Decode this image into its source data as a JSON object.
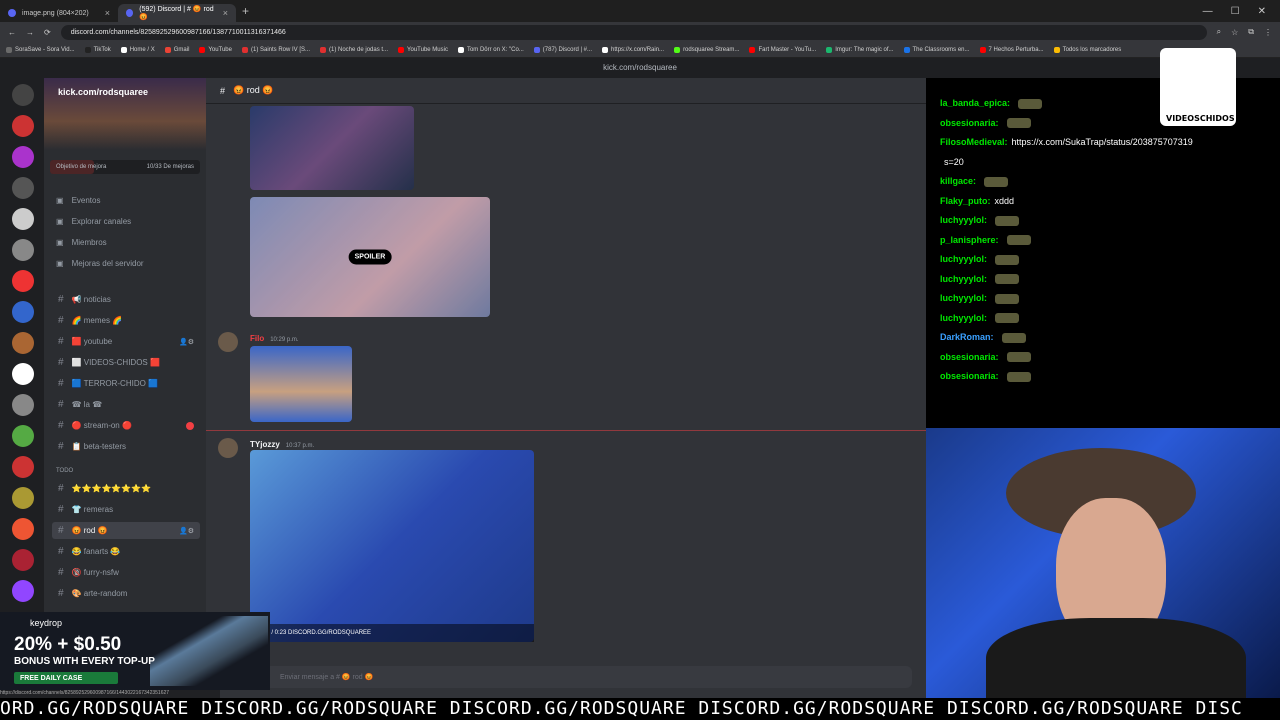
{
  "browser": {
    "tabs": [
      {
        "label": "image.png (804×202)",
        "active": false
      },
      {
        "label": "(592) Discord | # 😡 rod 😡",
        "active": true
      }
    ],
    "url": "discord.com/channels/825892529600987166/1387710011316371466",
    "bookmarks": [
      "SoraSave - Sora Vid...",
      "TikTok",
      "Home / X",
      "Gmail",
      "YouTube",
      "(1) Saints Row IV [S...",
      "(1) Noche de jodas t...",
      "YouTube Music",
      "Tom Dörr on X: \"Co...",
      "(787) Discord | #...",
      "https://x.com/Rain...",
      "rodsquaree Stream...",
      "Fart Master - YouTu...",
      "Imgur: The magic of...",
      "The Classrooms en...",
      "7 Hechos Perturba...",
      "Todos los marcadores"
    ]
  },
  "discord": {
    "window_title": "kick.com/rodsquaree",
    "guild": {
      "name": "kick.com/rodsquaree",
      "boost_goal": "Objetivo de mejora",
      "boost_count": "10/33 De mejoras"
    },
    "nav": [
      "Eventos",
      "Explorar canales",
      "Miembros",
      "Mejoras del servidor"
    ],
    "channels": [
      {
        "name": "📢 noticias"
      },
      {
        "name": "🌈 memes 🌈"
      },
      {
        "name": "🟥 youtube"
      },
      {
        "name": "⬜ VIDEOS-CHIDOS 🟥"
      },
      {
        "name": "🟦 TERROR-CHIDO 🟦"
      },
      {
        "name": "☎ la ☎"
      },
      {
        "name": "🔴 stream-on 🔴"
      },
      {
        "name": "📋 beta-testers"
      }
    ],
    "category": "TODO",
    "channels2": [
      {
        "name": "⭐⭐⭐⭐⭐⭐⭐⭐"
      },
      {
        "name": "👕 remeras"
      },
      {
        "name": "😡 rod 😡"
      },
      {
        "name": "😂 fanarts 😂"
      },
      {
        "name": "🔞 furry-nsfw"
      },
      {
        "name": "🎨 arte-random"
      }
    ],
    "chat_header": "😡 rod 😡",
    "spoiler_label": "SPOILER",
    "messages": [
      {
        "author": "Filo",
        "time": "10:29 p.m."
      },
      {
        "author": "TYjozzy",
        "time": "10:37 p.m."
      }
    ],
    "video_overlay": "0:15 / 0:23   DISCORD.GG/RODSQUAREE",
    "composer_placeholder": "Enviar mensaje a # 😡 rod 😡"
  },
  "stream_chat": [
    {
      "user": "la_banda_epica:",
      "text": "",
      "color": "#00e701"
    },
    {
      "user": "obsesionaria:",
      "text": "",
      "color": "#00e701"
    },
    {
      "user": "FilosoMedieval:",
      "text": "https://x.com/SukaTrap/status/203875707319",
      "color": "#00e701"
    },
    {
      "user": "",
      "text": "s=20",
      "color": "#ffffff"
    },
    {
      "user": "killgace:",
      "text": "",
      "color": "#00e701"
    },
    {
      "user": "Flaky_puto:",
      "text": "xddd",
      "color": "#00e701"
    },
    {
      "user": "luchyyylol:",
      "text": "",
      "color": "#00e701"
    },
    {
      "user": "p_lanisphere:",
      "text": "",
      "color": "#00e701"
    },
    {
      "user": "luchyyylol:",
      "text": "",
      "color": "#00e701"
    },
    {
      "user": "luchyyylol:",
      "text": "",
      "color": "#00e701"
    },
    {
      "user": "luchyyylol:",
      "text": "",
      "color": "#00e701"
    },
    {
      "user": "luchyyylol:",
      "text": "",
      "color": "#00e701"
    },
    {
      "user": "DarkRoman:",
      "text": "",
      "color": "#3aa0ff"
    },
    {
      "user": "obsesionaria:",
      "text": "",
      "color": "#00e701"
    },
    {
      "user": "obsesionaria:",
      "text": "",
      "color": "#00e701"
    }
  ],
  "logo_text": "VIDEOSCHIDOS",
  "ad": {
    "brand": "keydrop",
    "headline": "20% + $0.50",
    "subline": "BONUS WITH EVERY TOP-UP",
    "cta": "FREE DAILY CASE"
  },
  "status_url": "https://discord.com/channels/825892529600987166/1443022167342351627",
  "ticker": "ORD.GG/RODSQUARE DISCORD.GG/RODSQUARE DISCORD.GG/RODSQUARE DISCORD.GG/RODSQUARE DISCORD.GG/RODSQUARE DISC"
}
